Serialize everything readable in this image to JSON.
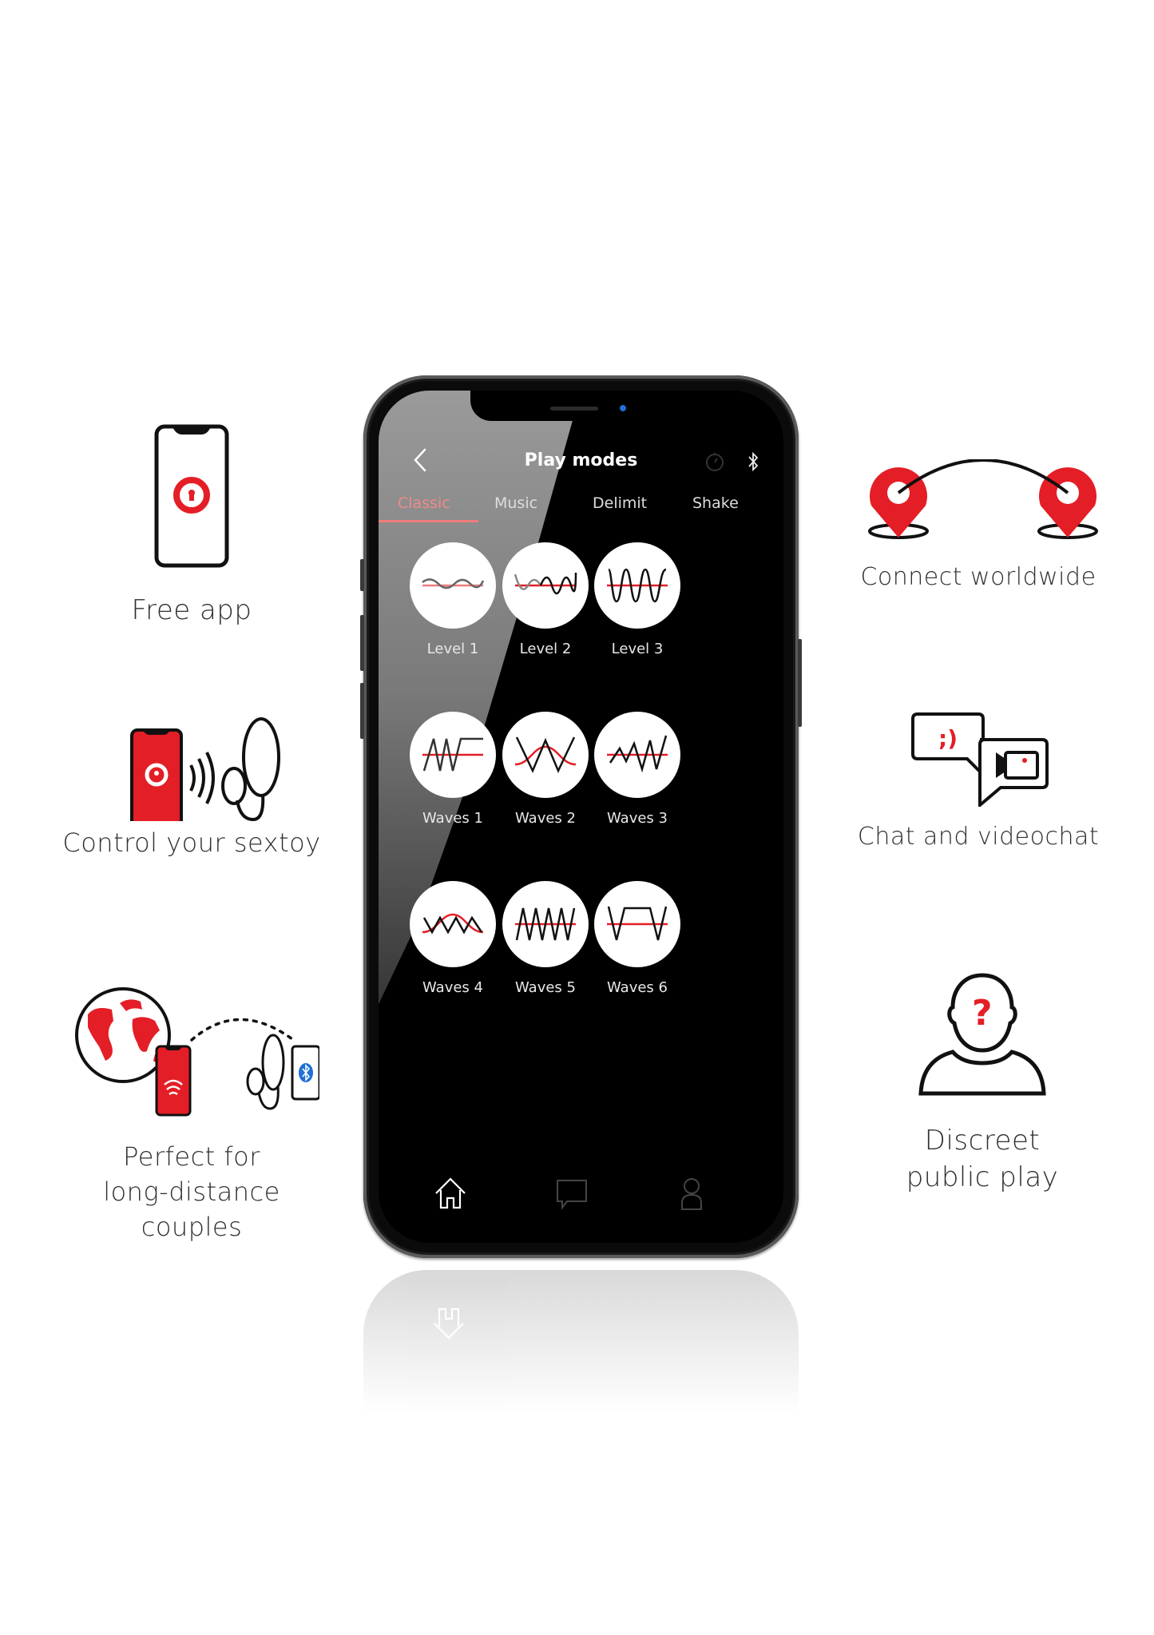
{
  "app": {
    "screen_title": "Play modes",
    "header_icons": [
      "back-chevron-icon",
      "timer-icon",
      "bluetooth-icon"
    ],
    "tabs": [
      {
        "label": "Classic",
        "active": true
      },
      {
        "label": "Music",
        "active": false
      },
      {
        "label": "Delimit",
        "active": false
      },
      {
        "label": "Shake",
        "active": false
      }
    ],
    "modes": [
      {
        "label": "Level 1",
        "icon": "wave-level-1-icon"
      },
      {
        "label": "Level 2",
        "icon": "wave-level-2-icon"
      },
      {
        "label": "Level 3",
        "icon": "wave-level-3-icon"
      },
      {
        "label": "Waves 1",
        "icon": "waves-1-icon"
      },
      {
        "label": "Waves 2",
        "icon": "waves-2-icon"
      },
      {
        "label": "Waves 3",
        "icon": "waves-3-icon"
      },
      {
        "label": "Waves 4",
        "icon": "waves-4-icon"
      },
      {
        "label": "Waves 5",
        "icon": "waves-5-icon"
      },
      {
        "label": "Waves 6",
        "icon": "waves-6-icon"
      }
    ],
    "bottom_nav": [
      {
        "name": "home",
        "icon": "home-icon",
        "active": true
      },
      {
        "name": "chat",
        "icon": "chat-icon",
        "active": false
      },
      {
        "name": "profile",
        "icon": "user-icon",
        "active": false
      }
    ],
    "colors": {
      "accent": "#f07c7c",
      "brand_red": "#e41e26",
      "screen_bg": "#000000"
    }
  },
  "features": {
    "free_app": {
      "lines": [
        "Free app"
      ],
      "icon": "phone-keyhole-icon"
    },
    "control": {
      "lines": [
        "Control your sextoy"
      ],
      "icon": "phone-wireless-toy-icon"
    },
    "long_distance": {
      "lines": [
        "Perfect for",
        "long-distance",
        "couples"
      ],
      "icon": "globe-phone-toy-icon"
    },
    "connect": {
      "lines": [
        "Connect worldwide"
      ],
      "icon": "map-pins-arc-icon"
    },
    "chat": {
      "lines": [
        "Chat and videochat"
      ],
      "icon": "chat-video-bubbles-icon"
    },
    "discreet": {
      "lines": [
        "Discreet",
        "public play"
      ],
      "icon": "anonymous-person-icon"
    }
  }
}
